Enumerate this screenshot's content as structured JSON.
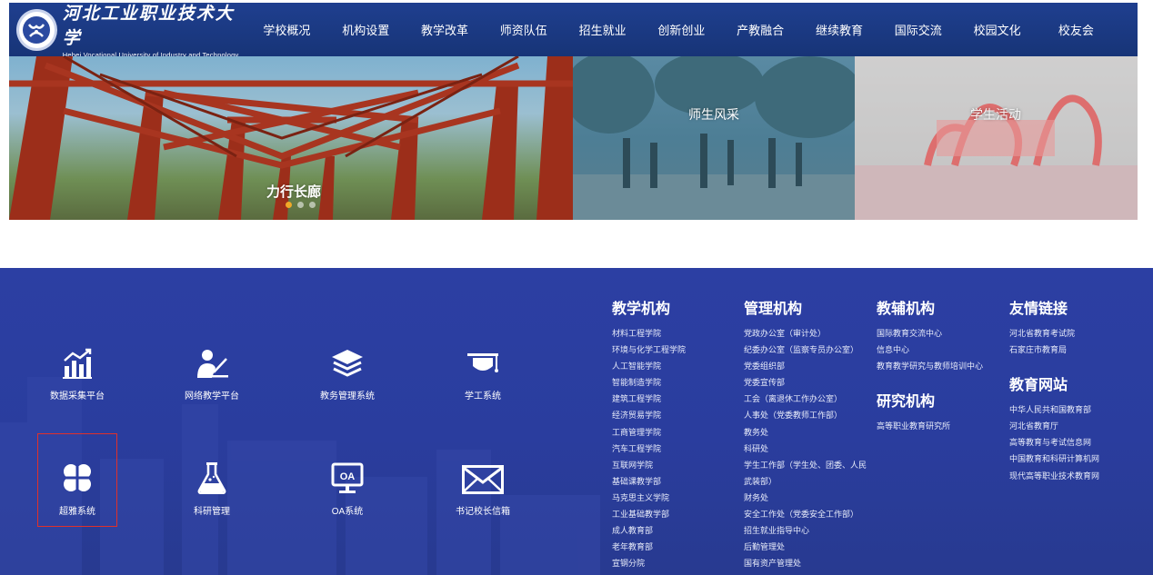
{
  "header": {
    "logo_cn": "河北工业职业技术大学",
    "logo_en": "Hebei Vocational University of Industry and Technology",
    "nav": [
      "学校概况",
      "机构设置",
      "教学改革",
      "师资队伍",
      "招生就业",
      "创新创业",
      "产教融合",
      "继续教育",
      "国际交流",
      "校园文化",
      "校友会"
    ]
  },
  "banner": {
    "slides": [
      "力行长廊",
      "师生风采",
      "学生活动"
    ]
  },
  "tiles": [
    {
      "label": "数据采集平台",
      "icon": "chart-icon"
    },
    {
      "label": "网络教学平台",
      "icon": "teacher-icon"
    },
    {
      "label": "教务管理系统",
      "icon": "layers-icon"
    },
    {
      "label": "学工系统",
      "icon": "graduation-cap-icon"
    },
    {
      "label": "超雅系统",
      "icon": "clover-icon"
    },
    {
      "label": "科研管理",
      "icon": "flask-icon"
    },
    {
      "label": "OA系统",
      "icon": "monitor-oa-icon"
    },
    {
      "label": "书记校长信箱",
      "icon": "mail-icon"
    }
  ],
  "columns": {
    "teaching": {
      "title": "教学机构",
      "links": [
        "材料工程学院",
        "环境与化学工程学院",
        "人工智能学院",
        "智能制造学院",
        "建筑工程学院",
        "经济贸易学院",
        "工商管理学院",
        "汽车工程学院",
        "互联网学院",
        "基础课教学部",
        "马克思主义学院",
        "工业基础教学部",
        "成人教育部",
        "老年教育部",
        "宣钢分院"
      ]
    },
    "admin": {
      "title": "管理机构",
      "links": [
        "党政办公室（审计处）",
        "纪委办公室（监察专员办公室）",
        "党委组织部",
        "党委宣传部",
        "工会（离退休工作办公室）",
        "人事处（党委教师工作部）",
        "教务处",
        "科研处",
        "学生工作部（学生处、团委、人民武装部）",
        "财务处",
        "安全工作处（党委安全工作部）",
        "招生就业指导中心",
        "后勤管理处",
        "国有资产管理处"
      ]
    },
    "support": {
      "title": "教辅机构",
      "links": [
        "国际教育交流中心",
        "信息中心",
        "教育教学研究与教师培训中心"
      ]
    },
    "research": {
      "title": "研究机构",
      "links": [
        "高等职业教育研究所"
      ]
    },
    "friends": {
      "title": "友情链接",
      "links": [
        "河北省教育考试院",
        "石家庄市教育局"
      ]
    },
    "edu": {
      "title": "教育网站",
      "links": [
        "中华人民共和国教育部",
        "河北省教育厅",
        "高等教育与考试信息网",
        "中国教育和科研计算机网",
        "现代高等职业技术教育网"
      ]
    }
  }
}
